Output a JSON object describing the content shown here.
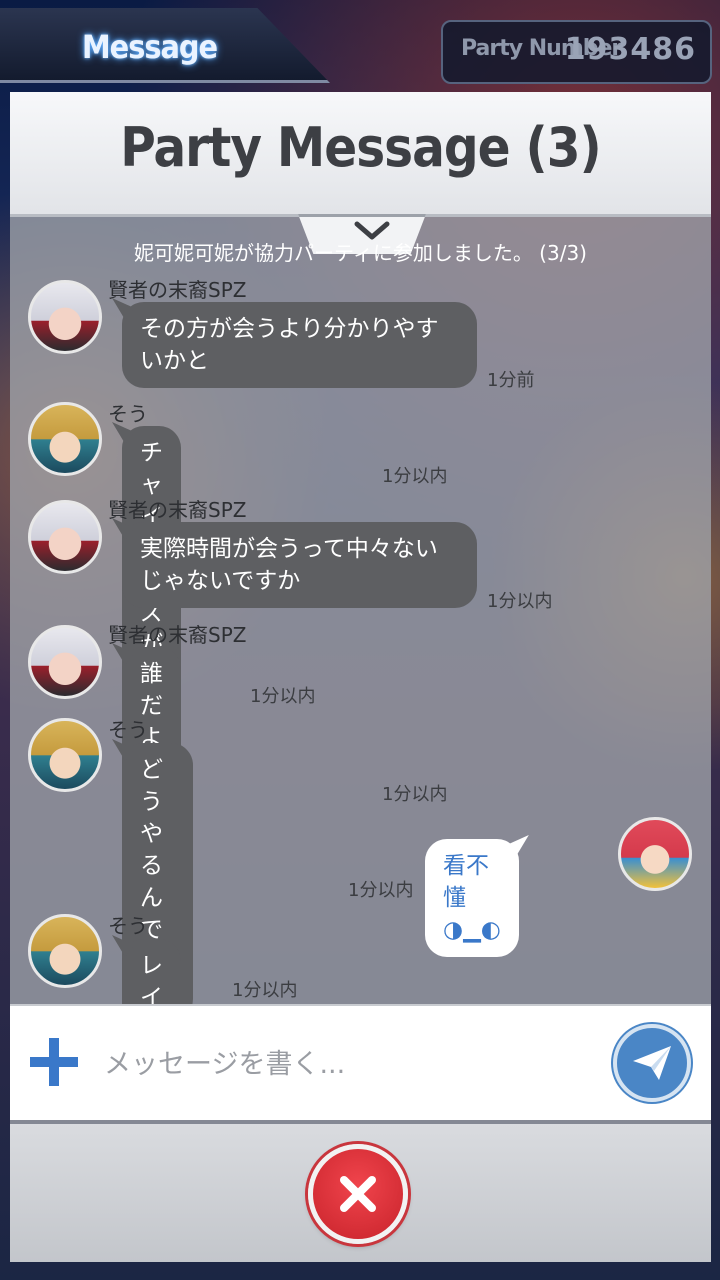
{
  "header": {
    "tab_label": "Message",
    "party_number_label": "Party Number",
    "party_number_value": "193486"
  },
  "panel": {
    "title": "Party Message (3)",
    "collapse_icon": "chevron-down-icon"
  },
  "system_notice": "妮可妮可妮が協力パーティに参加しました。 (3/3)",
  "messages": [
    {
      "sender": "賢者の末裔SPZ",
      "text_lines": [
        "その方が会うより分かりやす",
        "いかと"
      ],
      "time": "1分前",
      "avatar": "silver-hair-avatar"
    },
    {
      "sender": "そう",
      "text_lines": [
        "チャイニーズがいる"
      ],
      "time": "1分以内",
      "avatar": "blonde-hair-avatar"
    },
    {
      "sender": "賢者の末裔SPZ",
      "text_lines": [
        "実際時間が会うって中々ない",
        "じゃないですか"
      ],
      "time": "1分以内",
      "avatar": "silver-hair-avatar"
    },
    {
      "sender": "賢者の末裔SPZ",
      "text_lines": [
        "誰だよw"
      ],
      "time": "1分以内",
      "avatar": "silver-hair-avatar"
    },
    {
      "sender": "そう",
      "text_lines": [
        "どうやるんですか?"
      ],
      "time": "1分以内",
      "avatar": "blonde-hair-avatar"
    },
    {
      "sender": "",
      "text_lines": [
        "看不懂◑▁◐"
      ],
      "time": "1分以内",
      "avatar": "red-hair-avatar",
      "mine": true
    },
    {
      "sender": "そう",
      "text_lines": [
        "レイン"
      ],
      "time": "1分以内",
      "avatar": "blonde-hair-avatar"
    }
  ],
  "input": {
    "placeholder": "メッセージを書く...",
    "value": "",
    "add_icon": "plus-icon",
    "send_icon": "paper-plane-icon"
  },
  "footer": {
    "close_icon": "close-icon"
  },
  "colors": {
    "bubble_other": "#5e5f62",
    "bubble_mine": "#ffffff",
    "mine_text": "#3a78c9",
    "send_button": "#4a86c6",
    "close_button": "#d62c34"
  }
}
